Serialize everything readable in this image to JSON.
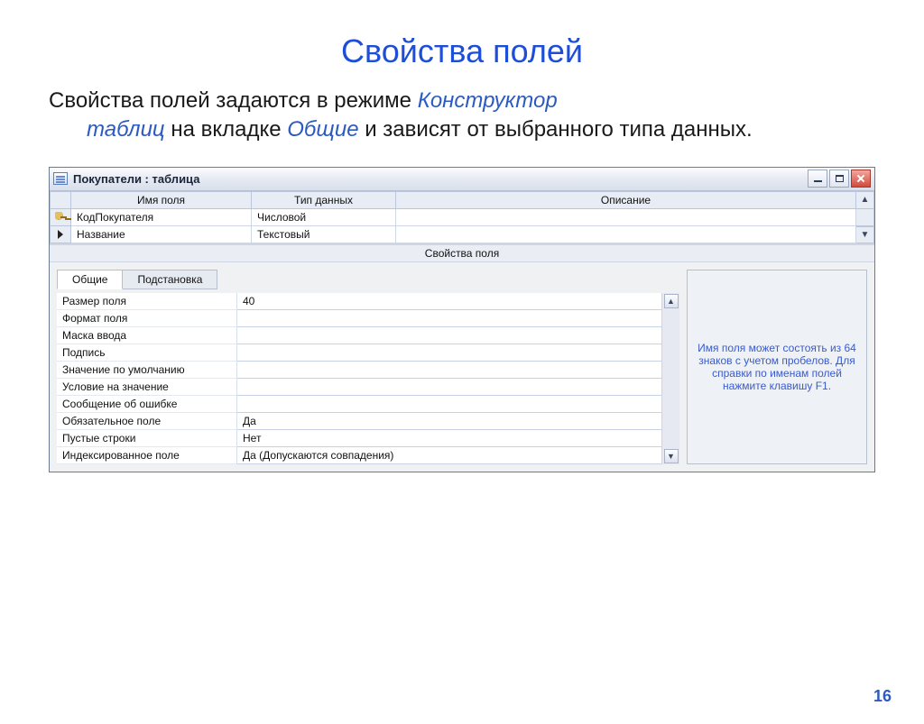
{
  "slide": {
    "title": "Свойства полей",
    "body_prefix": "Свойства полей задаются в режиме ",
    "em1": "Конструктор",
    "em2": "таблиц",
    "mid": " на вкладке ",
    "em3": "Общие",
    "suffix": " и зависят от выбранного типа данных.",
    "page_number": "16"
  },
  "window": {
    "title": "Покупатели : таблица"
  },
  "columns": {
    "name": "Имя поля",
    "type": "Тип данных",
    "desc": "Описание"
  },
  "rows": [
    {
      "name": "КодПокупателя",
      "type": "Числовой",
      "desc": ""
    },
    {
      "name": "Название",
      "type": "Текстовый",
      "desc": ""
    }
  ],
  "section_label": "Свойства поля",
  "tabs": {
    "general": "Общие",
    "lookup": "Подстановка"
  },
  "props": [
    {
      "name": "Размер поля",
      "value": "40"
    },
    {
      "name": "Формат поля",
      "value": ""
    },
    {
      "name": "Маска ввода",
      "value": ""
    },
    {
      "name": "Подпись",
      "value": ""
    },
    {
      "name": "Значение по умолчанию",
      "value": ""
    },
    {
      "name": "Условие на значение",
      "value": ""
    },
    {
      "name": "Сообщение об ошибке",
      "value": ""
    },
    {
      "name": "Обязательное поле",
      "value": "Да"
    },
    {
      "name": "Пустые строки",
      "value": "Нет"
    },
    {
      "name": "Индексированное поле",
      "value": "Да (Допускаются совпадения)"
    }
  ],
  "help_text": "Имя поля может состоять из 64 знаков с учетом пробелов.  Для справки по именам полей нажмите клавишу F1."
}
